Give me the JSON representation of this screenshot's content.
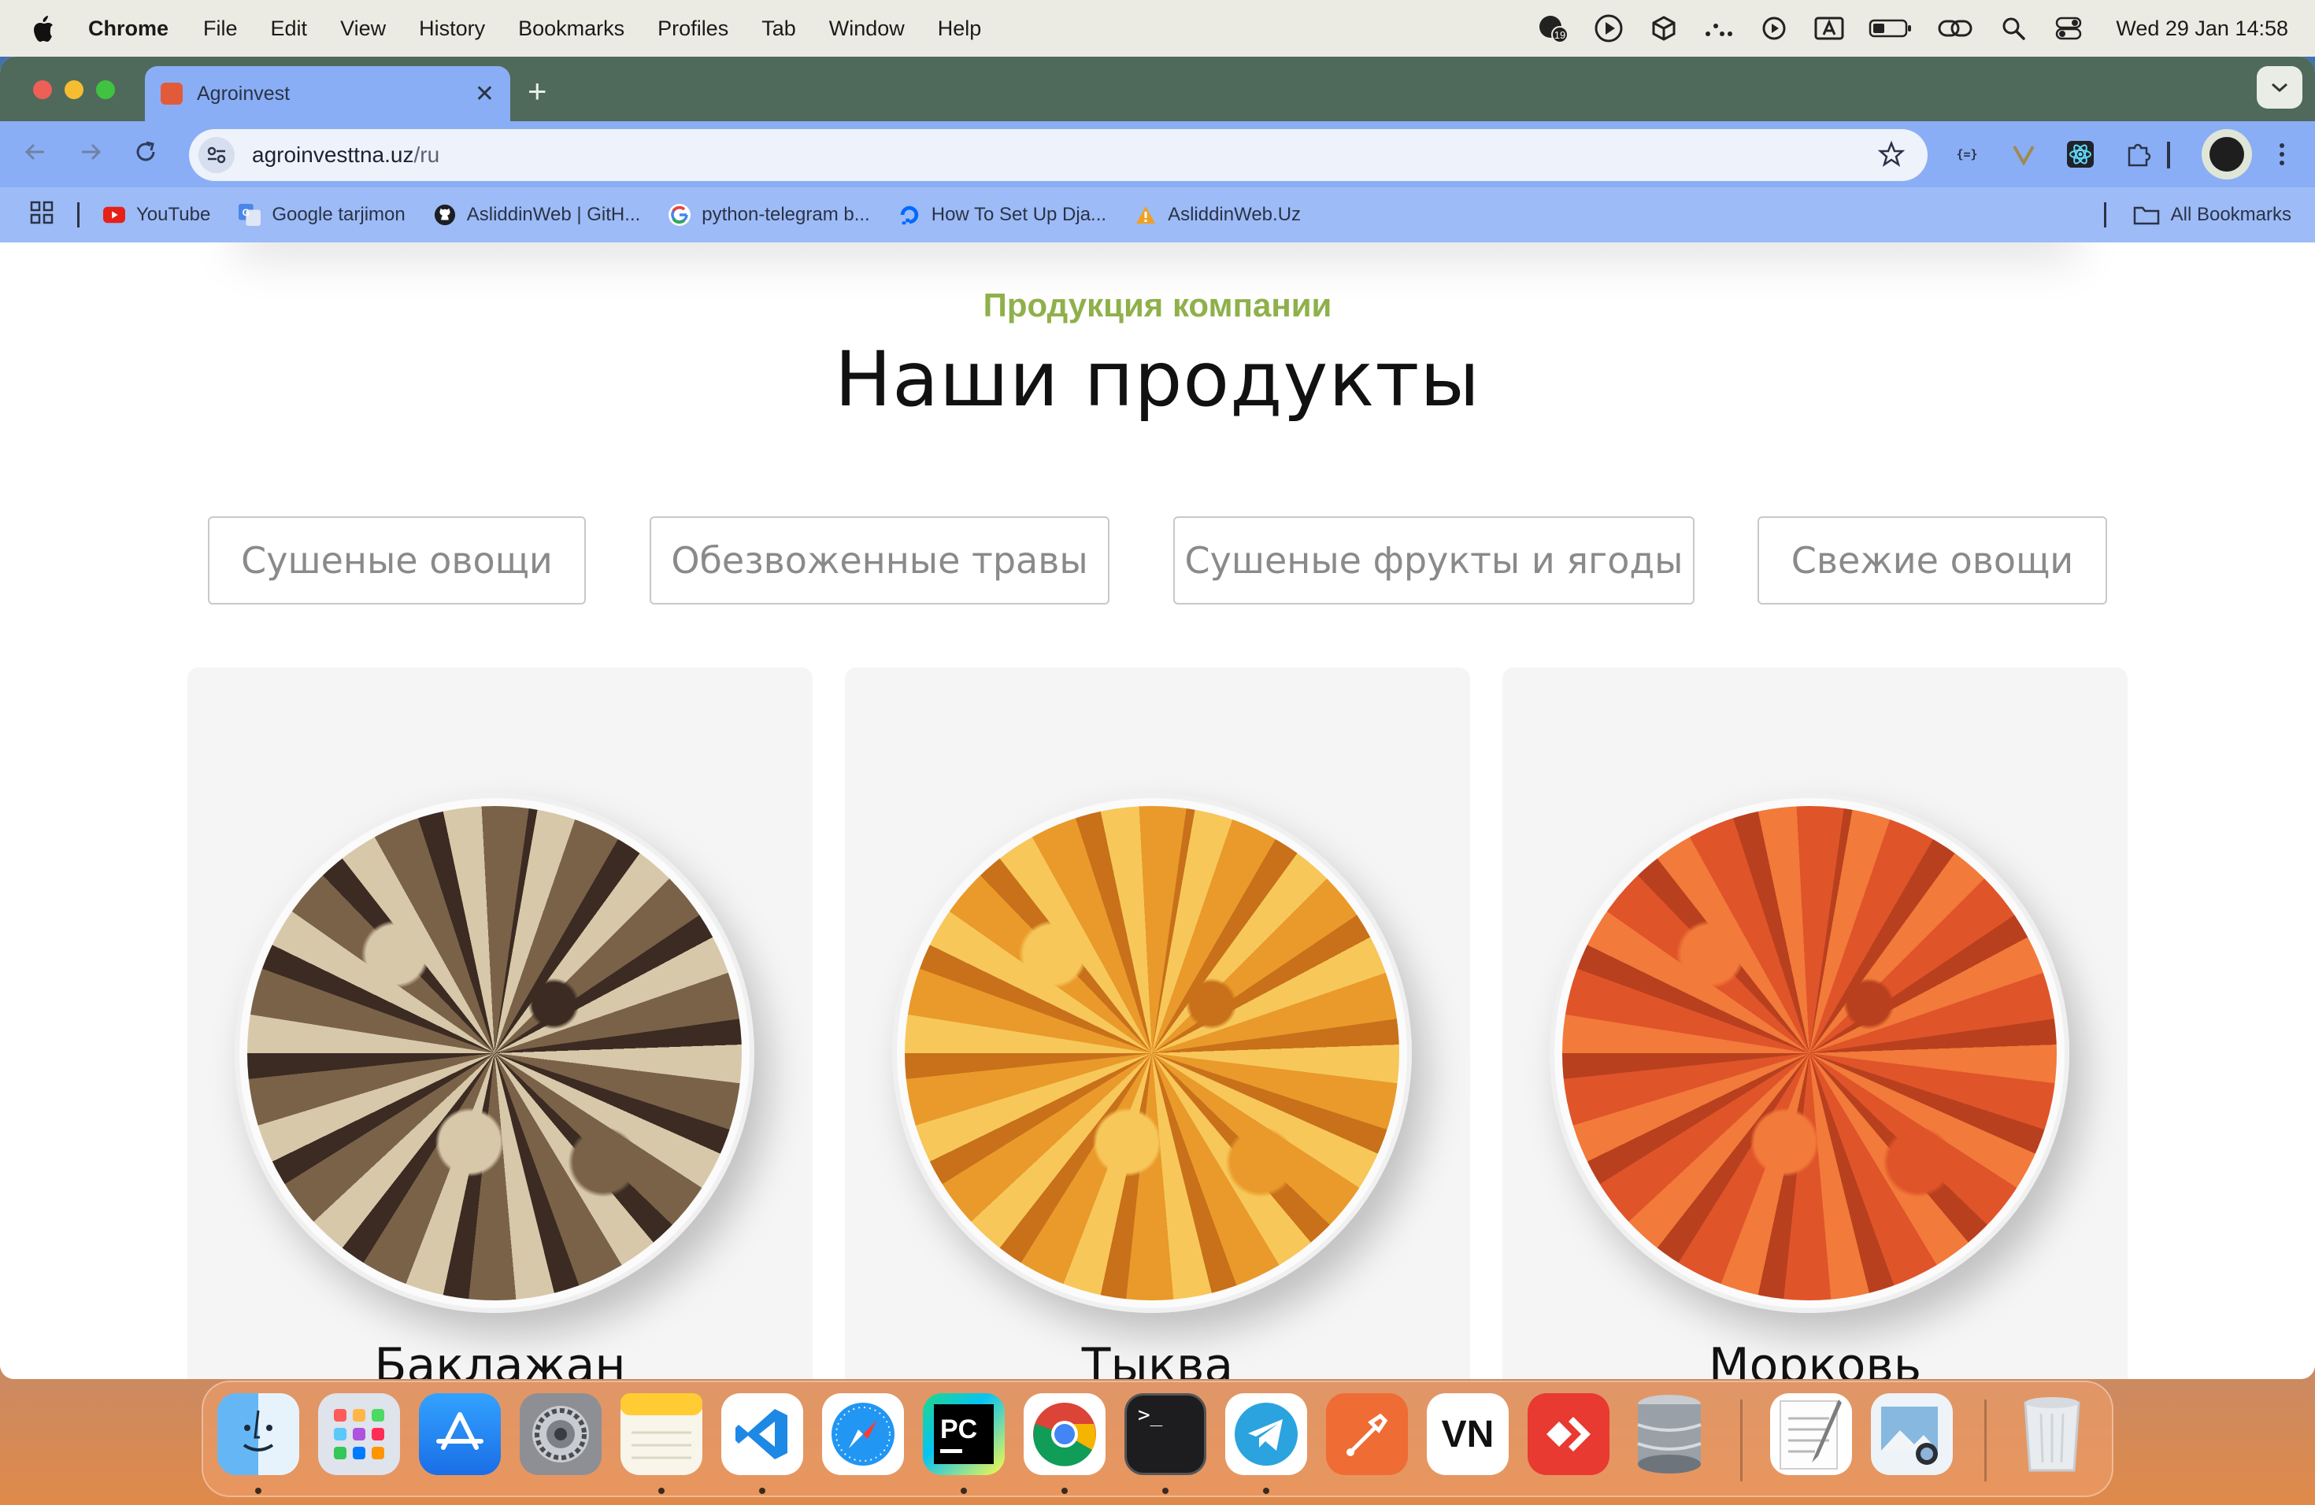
{
  "menubar": {
    "app_name": "Chrome",
    "items": [
      "File",
      "Edit",
      "View",
      "History",
      "Bookmarks",
      "Profiles",
      "Tab",
      "Window",
      "Help"
    ],
    "clock": "Wed 29 Jan  14:58",
    "status_icons": [
      "notification-badge-icon",
      "play-circle-icon",
      "cube-icon",
      "dots-icon",
      "play-icon",
      "input-source-icon",
      "battery-icon",
      "link-icon",
      "search-icon",
      "control-center-icon"
    ],
    "badge_count": "19"
  },
  "browser": {
    "tab_title": "Agroinvest",
    "url_host": "agroinvesttna.uz",
    "url_path": "/ru",
    "extensions": [
      "json-viewer-icon",
      "v-icon",
      "react-devtools-icon",
      "puzzle-icon"
    ],
    "bookmarks": [
      {
        "label": "YouTube",
        "icon": "youtube-icon",
        "color": "#e62117"
      },
      {
        "label": "Google tarjimon",
        "icon": "google-translate-icon",
        "color": "#4a86e8"
      },
      {
        "label": "AsliddinWeb | GitH...",
        "icon": "github-icon",
        "color": "#1b1f23"
      },
      {
        "label": "python-telegram b...",
        "icon": "google-icon",
        "color": "#ffffff"
      },
      {
        "label": "How To Set Up Dja...",
        "icon": "digitalocean-icon",
        "color": "#0069ff"
      },
      {
        "label": "AsliddinWeb.Uz",
        "icon": "warning-icon",
        "color": "#f0a020"
      }
    ],
    "all_bookmarks": "All Bookmarks"
  },
  "page": {
    "eyebrow": "Продукция компании",
    "headline": "Наши продукты",
    "filters": [
      "Сушеные овощи",
      "Обезвоженные травы",
      "Сушеные фрукты и ягоды",
      "Свежие овощи"
    ],
    "products": [
      {
        "name": "Баклажан",
        "colors": [
          "#d8c8aa",
          "#7a6248",
          "#3b2b22"
        ]
      },
      {
        "name": "Тыква",
        "colors": [
          "#f7c75a",
          "#e99a2a",
          "#c8701a"
        ]
      },
      {
        "name": "Морковь",
        "colors": [
          "#f27a3a",
          "#e0542a",
          "#b8401e"
        ]
      }
    ]
  },
  "dock": {
    "apps": [
      "finder-icon",
      "launchpad-icon",
      "app-store-icon",
      "system-settings-icon",
      "notes-icon",
      "vscode-icon",
      "safari-icon",
      "pycharm-icon",
      "chrome-icon",
      "terminal-icon",
      "telegram-icon",
      "postman-icon",
      "vn-icon",
      "anydesk-icon",
      "database-icon",
      "textedit-icon",
      "preview-icon",
      "trash-icon"
    ],
    "pycharm_label": "PC",
    "vn_label": "VN",
    "terminal_prompt": ">_"
  }
}
